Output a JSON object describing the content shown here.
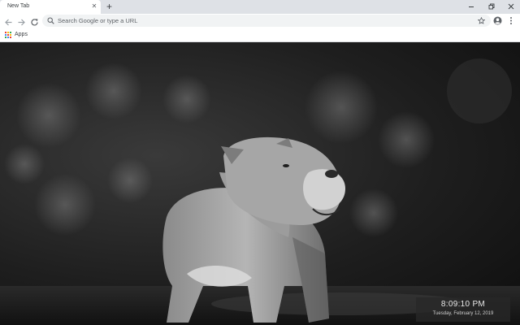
{
  "browser": {
    "tab": {
      "title": "New Tab",
      "close_icon": "close-icon"
    },
    "new_tab_icon": "plus-icon",
    "window_controls": [
      "minimize-icon",
      "restore-icon",
      "close-icon"
    ],
    "toolbar": {
      "nav_icons": [
        "back-arrow-icon",
        "forward-arrow-icon",
        "reload-icon"
      ],
      "omnibox": {
        "placeholder": "Search Google or type a URL",
        "value": ""
      },
      "right_icons": [
        "star-icon",
        "profile-icon",
        "menu-icon"
      ]
    },
    "bookmarks": {
      "apps_label": "Apps",
      "apps_colors": [
        "#ea4335",
        "#fbbc05",
        "#34a853",
        "#4285f4",
        "#ea4335",
        "#fbbc05",
        "#34a853",
        "#4285f4",
        "#ea4335"
      ]
    }
  },
  "page": {
    "background": "Black-and-white photo of a bulldog standing outdoors",
    "clock": {
      "time": "8:09:10 PM",
      "date": "Tuesday, February 12, 2019"
    }
  },
  "colors": {
    "tabstrip": "#dee1e6",
    "toolbar": "#ffffff",
    "omnibox": "#f1f3f4",
    "icon": "#5f6368"
  }
}
